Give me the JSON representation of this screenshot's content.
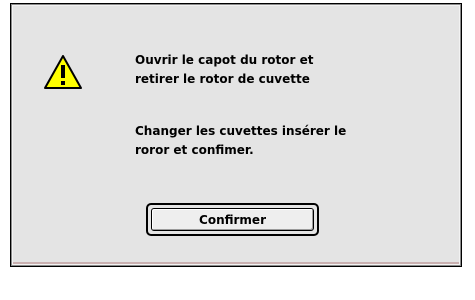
{
  "dialog": {
    "icon": "warning-icon",
    "message_1": {
      "line_1": "Ouvrir le capot du rotor et",
      "line_2": "retirer le rotor de cuvette"
    },
    "message_2": {
      "line_1": "Changer les cuvettes insérer le",
      "line_2": "roror et confimer."
    },
    "confirm_button_label": "Confirmer"
  },
  "colors": {
    "dialog_background": "#e4e4e4",
    "warning_yellow": "#ffff00",
    "border": "#000000"
  }
}
